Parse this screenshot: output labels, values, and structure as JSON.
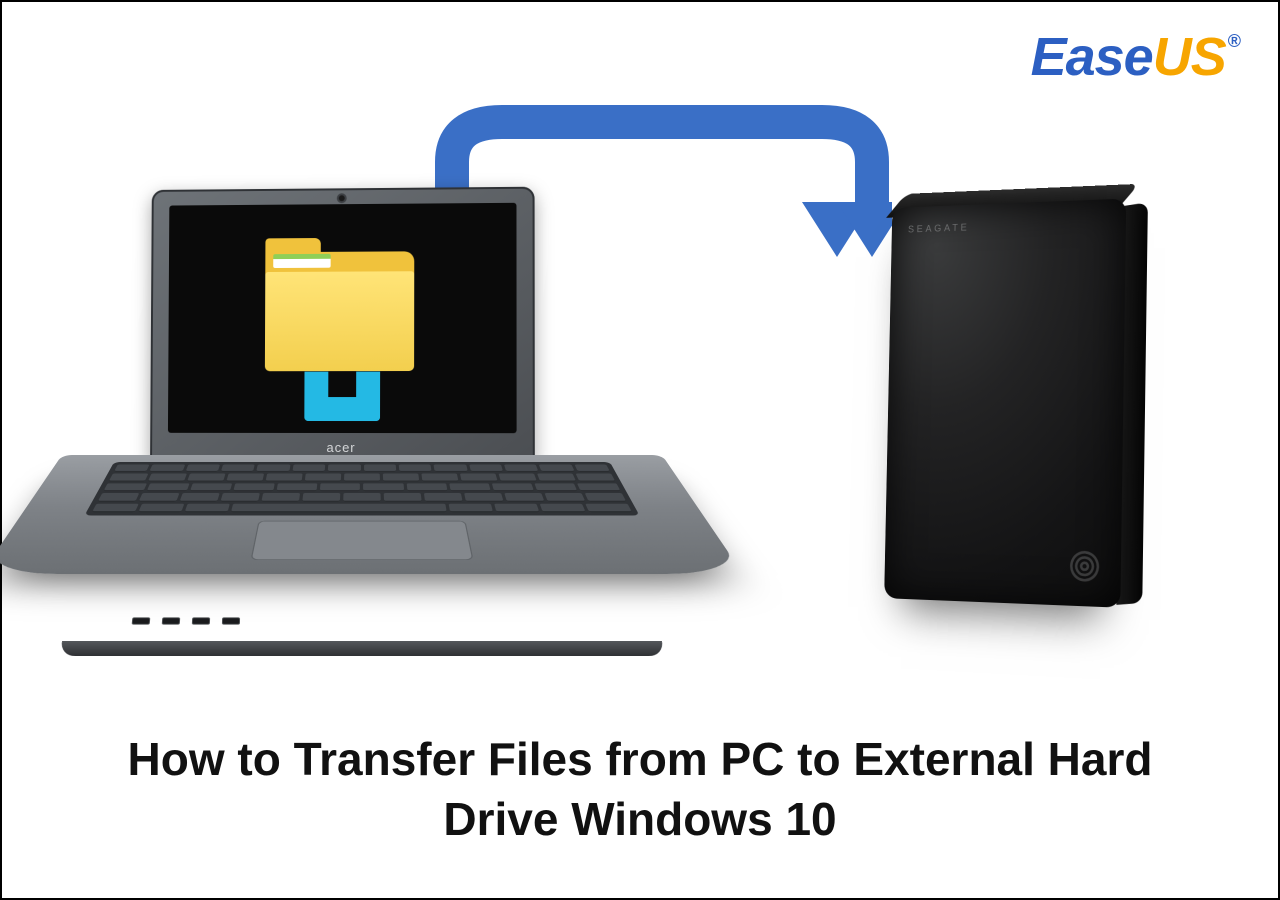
{
  "logo": {
    "part1": "Ease",
    "part2": "US",
    "registered": "®"
  },
  "laptop": {
    "brand": "acer",
    "icon_name": "file-explorer-icon"
  },
  "hdd": {
    "label": "SEAGATE",
    "logo_name": "seagate-spiral-icon"
  },
  "arrow": {
    "name": "transfer-arrow-icon",
    "color": "#3a6fc6"
  },
  "title": "How to Transfer Files from PC to External Hard Drive Windows 10"
}
